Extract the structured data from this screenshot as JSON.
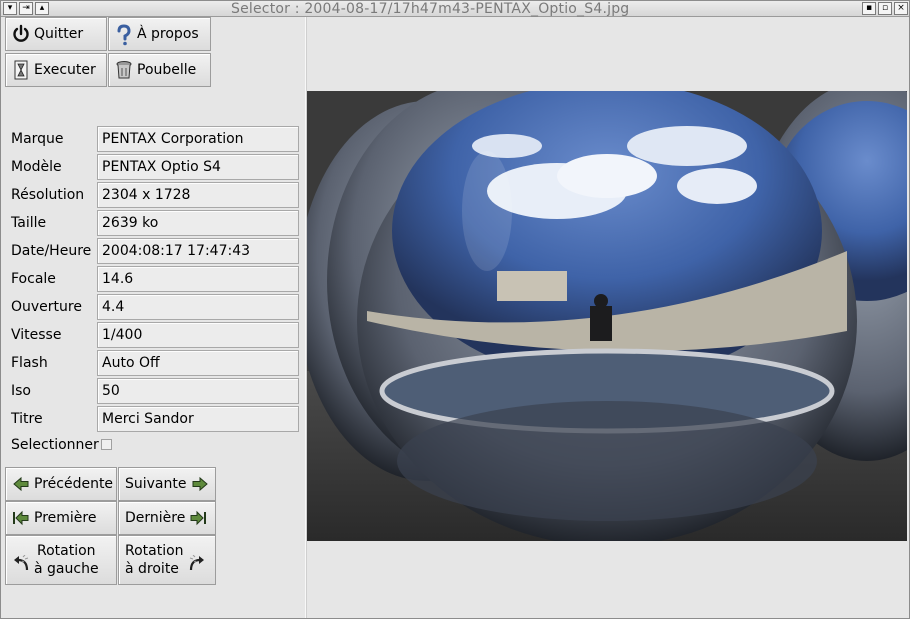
{
  "window": {
    "title": "Selector : 2004-08-17/17h47m43-PENTAX_Optio_S4.jpg"
  },
  "toolbar": {
    "quit_label": "Quitter",
    "about_label": "À propos",
    "execute_label": "Executer",
    "trash_label": "Poubelle"
  },
  "fields": [
    {
      "label": "Marque",
      "value": "PENTAX Corporation"
    },
    {
      "label": "Modèle",
      "value": "PENTAX Optio S4"
    },
    {
      "label": "Résolution",
      "value": "2304 x 1728"
    },
    {
      "label": "Taille",
      "value": "2639 ko"
    },
    {
      "label": "Date/Heure",
      "value": "2004:08:17 17:47:43"
    },
    {
      "label": "Focale",
      "value": "14.6"
    },
    {
      "label": "Ouverture",
      "value": "4.4"
    },
    {
      "label": "Vitesse",
      "value": "1/400"
    },
    {
      "label": "Flash",
      "value": "Auto Off"
    },
    {
      "label": "Iso",
      "value": "50"
    },
    {
      "label": "Titre",
      "value": "Merci Sandor"
    }
  ],
  "select": {
    "label": "Selectionner",
    "checked": false
  },
  "nav": {
    "previous_label": "Précédente",
    "next_label": "Suivante",
    "first_label": "Première",
    "last_label": "Dernière",
    "rotate_left_line1": "Rotation",
    "rotate_left_line2": "à gauche",
    "rotate_right_line1": "Rotation",
    "rotate_right_line2": "à droite"
  },
  "icons": {
    "quit": "power-icon",
    "about": "question-icon",
    "execute": "hourglass-icon",
    "trash": "trash-icon",
    "previous": "arrow-left-icon",
    "next": "arrow-right-icon",
    "first": "first-icon",
    "last": "last-icon",
    "rotate_left": "rotate-left-icon",
    "rotate_right": "rotate-right-icon"
  },
  "colors": {
    "arrow_green": "#5e8a3c",
    "help_blue": "#3a5fa0"
  }
}
